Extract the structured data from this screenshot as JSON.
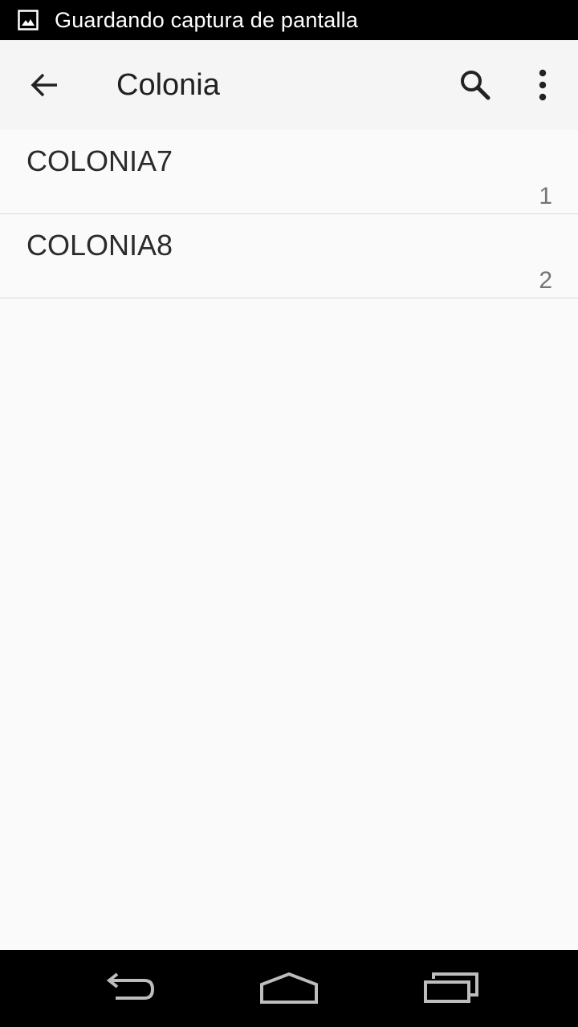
{
  "status_bar": {
    "notification_text": "Guardando captura de pantalla",
    "icon": "image-icon"
  },
  "app_bar": {
    "title": "Colonia",
    "back_icon": "arrow-back-icon",
    "search_icon": "search-icon",
    "overflow_icon": "more-vert-icon"
  },
  "list": {
    "items": [
      {
        "title": "COLONIA7",
        "count": "1"
      },
      {
        "title": "COLONIA8",
        "count": "2"
      }
    ]
  },
  "nav_bar": {
    "back_icon": "nav-back-icon",
    "home_icon": "nav-home-icon",
    "recents_icon": "nav-recents-icon"
  }
}
